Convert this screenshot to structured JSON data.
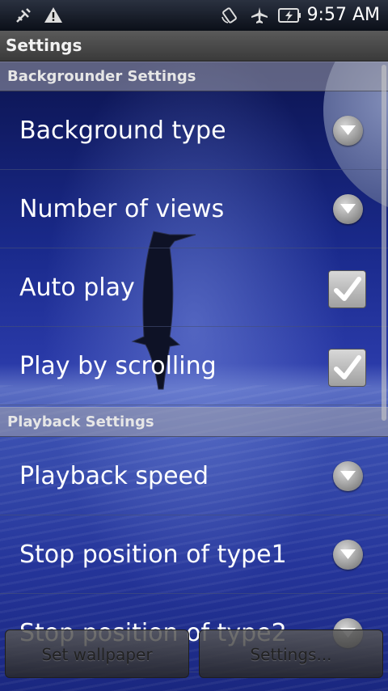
{
  "status_bar": {
    "time": "9:57 AM",
    "icons": [
      "usb-debug-icon",
      "warning-icon",
      "rotate-icon",
      "airplane-icon",
      "battery-charging-icon"
    ]
  },
  "title_bar": {
    "title": "Settings"
  },
  "sections": [
    {
      "header": "Backgrounder Settings",
      "items": [
        {
          "label": "Background type",
          "control": "dropdown"
        },
        {
          "label": "Number of views",
          "control": "dropdown"
        },
        {
          "label": "Auto play",
          "control": "checkbox",
          "checked": true
        },
        {
          "label": "Play by scrolling",
          "control": "checkbox",
          "checked": true
        }
      ]
    },
    {
      "header": "Playback Settings",
      "items": [
        {
          "label": "Playback speed",
          "control": "dropdown"
        },
        {
          "label": "Stop position of type1",
          "control": "dropdown"
        },
        {
          "label": "Stop position of type2",
          "control": "dropdown"
        }
      ]
    }
  ],
  "buttons": {
    "set_wallpaper": "Set wallpaper",
    "settings": "Settings..."
  }
}
